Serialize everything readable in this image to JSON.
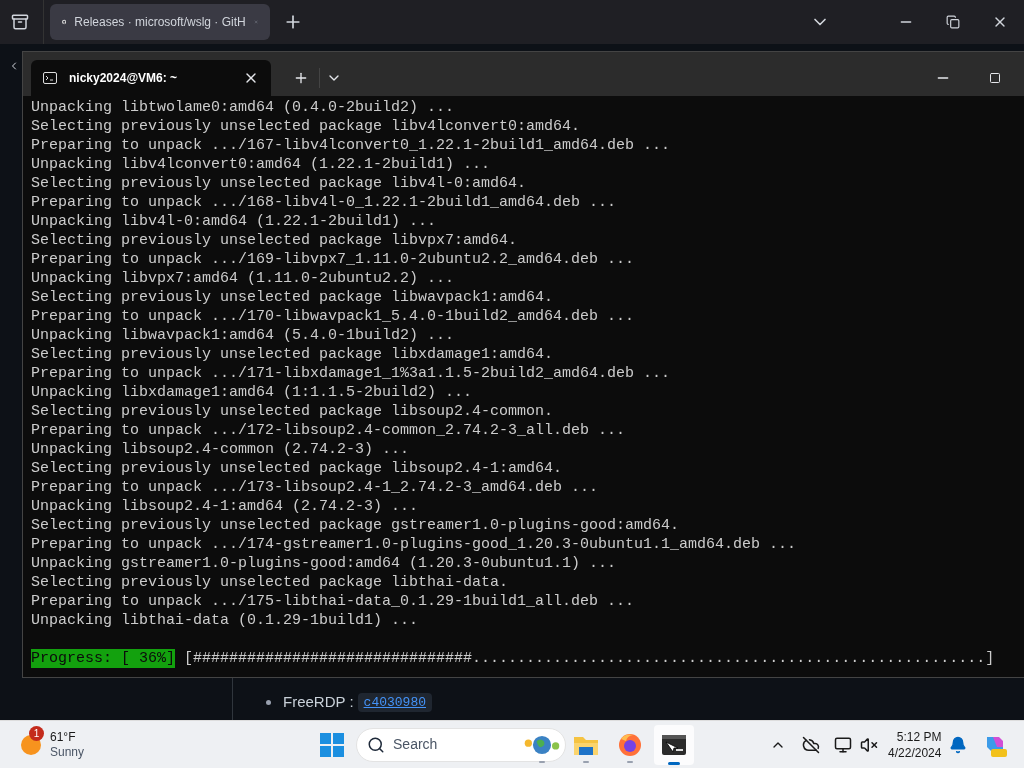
{
  "browser": {
    "tab": {
      "title": "Releases · microsoft/wslg · GitH",
      "selected": true
    }
  },
  "terminal": {
    "tab": {
      "title": "nicky2024@VM6: ~",
      "selected": true
    },
    "lines": [
      "Unpacking libtwolame0:amd64 (0.4.0-2build2) ...",
      "Selecting previously unselected package libv4lconvert0:amd64.",
      "Preparing to unpack .../167-libv4lconvert0_1.22.1-2build1_amd64.deb ...",
      "Unpacking libv4lconvert0:amd64 (1.22.1-2build1) ...",
      "Selecting previously unselected package libv4l-0:amd64.",
      "Preparing to unpack .../168-libv4l-0_1.22.1-2build1_amd64.deb ...",
      "Unpacking libv4l-0:amd64 (1.22.1-2build1) ...",
      "Selecting previously unselected package libvpx7:amd64.",
      "Preparing to unpack .../169-libvpx7_1.11.0-2ubuntu2.2_amd64.deb ...",
      "Unpacking libvpx7:amd64 (1.11.0-2ubuntu2.2) ...",
      "Selecting previously unselected package libwavpack1:amd64.",
      "Preparing to unpack .../170-libwavpack1_5.4.0-1build2_amd64.deb ...",
      "Unpacking libwavpack1:amd64 (5.4.0-1build2) ...",
      "Selecting previously unselected package libxdamage1:amd64.",
      "Preparing to unpack .../171-libxdamage1_1%3a1.1.5-2build2_amd64.deb ...",
      "Unpacking libxdamage1:amd64 (1:1.1.5-2build2) ...",
      "Selecting previously unselected package libsoup2.4-common.",
      "Preparing to unpack .../172-libsoup2.4-common_2.74.2-3_all.deb ...",
      "Unpacking libsoup2.4-common (2.74.2-3) ...",
      "Selecting previously unselected package libsoup2.4-1:amd64.",
      "Preparing to unpack .../173-libsoup2.4-1_2.74.2-3_amd64.deb ...",
      "Unpacking libsoup2.4-1:amd64 (2.74.2-3) ...",
      "Selecting previously unselected package gstreamer1.0-plugins-good:amd64.",
      "Preparing to unpack .../174-gstreamer1.0-plugins-good_1.20.3-0ubuntu1.1_amd64.deb ...",
      "Unpacking gstreamer1.0-plugins-good:amd64 (1.20.3-0ubuntu1.1) ...",
      "Selecting previously unselected package libthai-data.",
      "Preparing to unpack .../175-libthai-data_0.1.29-1build1_all.deb ...",
      "Unpacking libthai-data (0.1.29-1build1) ..."
    ],
    "progress": {
      "label": "Progress: [ 36%]",
      "bar": "[###############################.........................................................]"
    }
  },
  "page": {
    "items": [
      {
        "name": "FreeRDP :",
        "commit": "c4030980"
      }
    ]
  },
  "taskbar": {
    "weather": {
      "badge": "1",
      "temperature": "61°F",
      "condition": "Sunny"
    },
    "search": {
      "placeholder": "Search"
    },
    "apps": [
      {
        "kind": "widgets",
        "selected": false
      },
      {
        "kind": "files",
        "selected": false
      },
      {
        "kind": "firefox",
        "selected": false
      },
      {
        "kind": "terminal",
        "selected": true
      }
    ],
    "time": "5:12 PM",
    "date": "4/22/2024"
  }
}
